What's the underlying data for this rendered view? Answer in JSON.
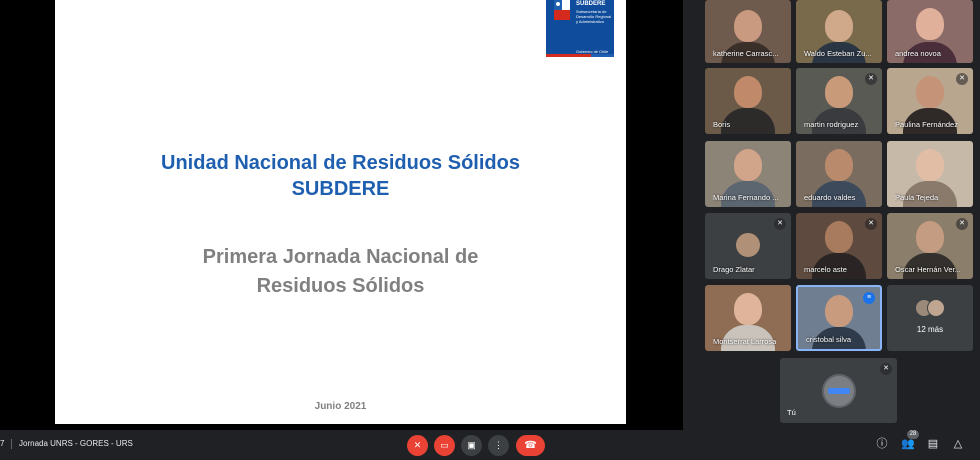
{
  "slide": {
    "logo": {
      "name": "SUBDERE",
      "subtitle": "Subsecretaría de Desarrollo Regional y Administrativo",
      "government": "Gobierno de Chile"
    },
    "title_line1": "Unidad Nacional de Residuos Sólidos",
    "title_line2": "SUBDERE",
    "subtitle_line1": "Primera Jornada Nacional de",
    "subtitle_line2": "Residuos Sólidos",
    "date": "Junio 2021"
  },
  "participants": [
    {
      "name": "katherine Carrasc...",
      "muted": false
    },
    {
      "name": "Waldo Esteban Zu...",
      "muted": false
    },
    {
      "name": "andrea novoa",
      "muted": false
    },
    {
      "name": "Boris",
      "muted": false
    },
    {
      "name": "martin rodriguez",
      "muted": true
    },
    {
      "name": "Paulina Fernández",
      "muted": true
    },
    {
      "name": "Marina Fernando ...",
      "muted": false
    },
    {
      "name": "eduardo valdes",
      "muted": false
    },
    {
      "name": "Paula Tejeda",
      "muted": false
    },
    {
      "name": "Drago Zlatar",
      "muted": true
    },
    {
      "name": "marcelo aste",
      "muted": true
    },
    {
      "name": "Oscar Hernán Ver...",
      "muted": true
    },
    {
      "name": "Montserrat Larrosa",
      "muted": false
    },
    {
      "name": "cristobal silva",
      "muted": false
    }
  ],
  "more_tile": {
    "label": "12 más"
  },
  "self_tile": {
    "label": "Tú"
  },
  "bottombar": {
    "time": "7",
    "meeting_title": "Jornada UNRS - GORES - URS",
    "participant_count": "28"
  },
  "icons": {
    "mic_off": "mic-off-icon",
    "camera_off": "camera-off-icon",
    "present": "present-icon",
    "more": "more-vert-icon",
    "leave": "call-end-icon",
    "info": "info-icon",
    "people": "people-icon",
    "chat": "chat-icon",
    "activities": "activities-icon"
  },
  "colors": {
    "meet_background": "#202124",
    "tile_background": "#3c4043",
    "danger": "#ea4335",
    "slide_title": "#1f5fb0",
    "slide_subtitle": "#808080",
    "speaking_border": "#8ab4f8"
  }
}
